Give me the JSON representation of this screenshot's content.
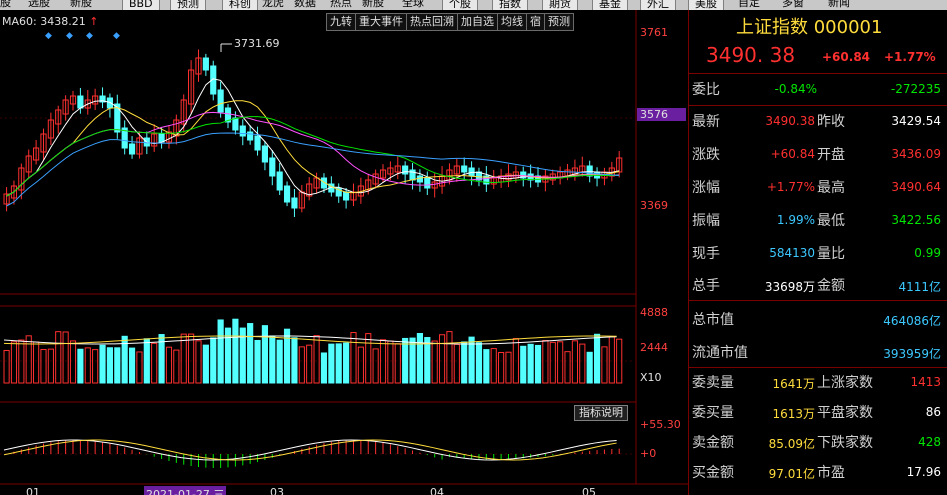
{
  "menu": {
    "items": [
      "股",
      "选股",
      "新股",
      "BBD",
      "预测",
      "科创",
      "龙虎",
      "数据",
      "热点",
      "新股",
      "全球",
      "个股",
      "指数",
      "期货",
      "基金",
      "外汇",
      "美股",
      "自定",
      "多窗",
      "新闻"
    ]
  },
  "chart": {
    "ma_label": "MA60: 3438.21",
    "ma_arrow": "↑",
    "toolbar": [
      "九转",
      "重大事件",
      "热点回溯",
      "加自选",
      "均线",
      "宿",
      "预测"
    ],
    "price_axis": {
      "top": "3761",
      "mid_highlight": "3576",
      "low": "3369"
    },
    "peak": "3731.69",
    "volume_axis": {
      "top": "4888",
      "mid": "2444",
      "unit": "X10"
    },
    "macd_axis": {
      "top": "+55.30",
      "zero": "+0"
    },
    "indicator_button": "指标说明",
    "date_labels": [
      "01",
      "2021-01-27 三",
      "03",
      "04",
      "05"
    ]
  },
  "quote": {
    "title": "上证指数 000001",
    "price": "3490. 38",
    "change": "+60.84",
    "change_pct": "+1.77%",
    "weibi": {
      "label": "委比",
      "pct": "-0.84%",
      "diff": "-272235"
    },
    "rows": [
      {
        "l1": "最新",
        "v1": "3490.38",
        "c1": "red",
        "l2": "昨收",
        "v2": "3429.54",
        "c2": "white"
      },
      {
        "l1": "涨跌",
        "v1": "+60.84",
        "c1": "red",
        "l2": "开盘",
        "v2": "3436.09",
        "c2": "red"
      },
      {
        "l1": "涨幅",
        "v1": "+1.77%",
        "c1": "red",
        "l2": "最高",
        "v2": "3490.64",
        "c2": "red"
      },
      {
        "l1": "振幅",
        "v1": "1.99%",
        "c1": "cyan",
        "l2": "最低",
        "v2": "3422.56",
        "c2": "green"
      },
      {
        "l1": "现手",
        "v1": "584130",
        "c1": "cyan",
        "l2": "量比",
        "v2": "0.99",
        "c2": "green"
      }
    ],
    "total_hands": {
      "label": "总手",
      "value": "33698万",
      "label2": "金额",
      "value2": "4111亿"
    },
    "market_cap": {
      "label": "总市值",
      "value": "464086亿"
    },
    "float_cap": {
      "label": "流通市值",
      "value": "393959亿"
    },
    "orders": [
      {
        "l1": "委卖量",
        "v1": "1641万",
        "l2": "上涨家数",
        "v2": "1413",
        "c2": "red"
      },
      {
        "l1": "委买量",
        "v1": "1613万",
        "l2": "平盘家数",
        "v2": "86",
        "c2": "white"
      },
      {
        "l1": "卖金额",
        "v1": "85.09亿",
        "l2": "下跌家数",
        "v2": "428",
        "c2": "green"
      },
      {
        "l1": "买金额",
        "v1": "97.01亿",
        "l2": "市盈",
        "v2": "17.96",
        "c2": "white"
      }
    ]
  },
  "colors": {
    "up": "#ff3030",
    "down": "#54ffff",
    "ma5": "#ffffff",
    "ma10": "#ffdc3c",
    "ma20": "#ff50ff",
    "ma30": "#00e600",
    "ma60": "#3aa0ff"
  }
}
